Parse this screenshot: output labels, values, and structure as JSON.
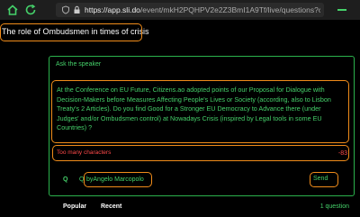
{
  "browser": {
    "url_host": "https://app.sli.do",
    "url_path": "/event/mkH2PQHPV2e2Z3BmI1A9Tf/live/questions?clusterIc"
  },
  "page": {
    "title": "The role of Ombudsmen in times of crisis"
  },
  "ask_form": {
    "label": "Ask the speaker",
    "question_text": "At the Conference on EU Future, Citizens.ao adopted points of our Proposal for Dialogue with Decision-Makers before Measures Affecting People's Lives or Society (according, also to Lisbon Treaty's 2 Articles). Do you find Good for a Stronger EU Democracy to Advance there (under Judges' and/or Ombudsmen control) at Nowadays Crisis (inspired  by Legal tools  in some EU Countries) ?",
    "error_text": "Too many characters",
    "char_count": "-83",
    "q_label": "Q",
    "author_prefix": "Q",
    "author_name": "byAngelo Marcopolo",
    "send_label": "Send"
  },
  "tabs": {
    "popular": "Popular",
    "recent": "Recent",
    "count": "1 question"
  },
  "colors": {
    "accent": "#45d16a",
    "highlight": "#f08c1a",
    "error": "#ff4a4a"
  }
}
